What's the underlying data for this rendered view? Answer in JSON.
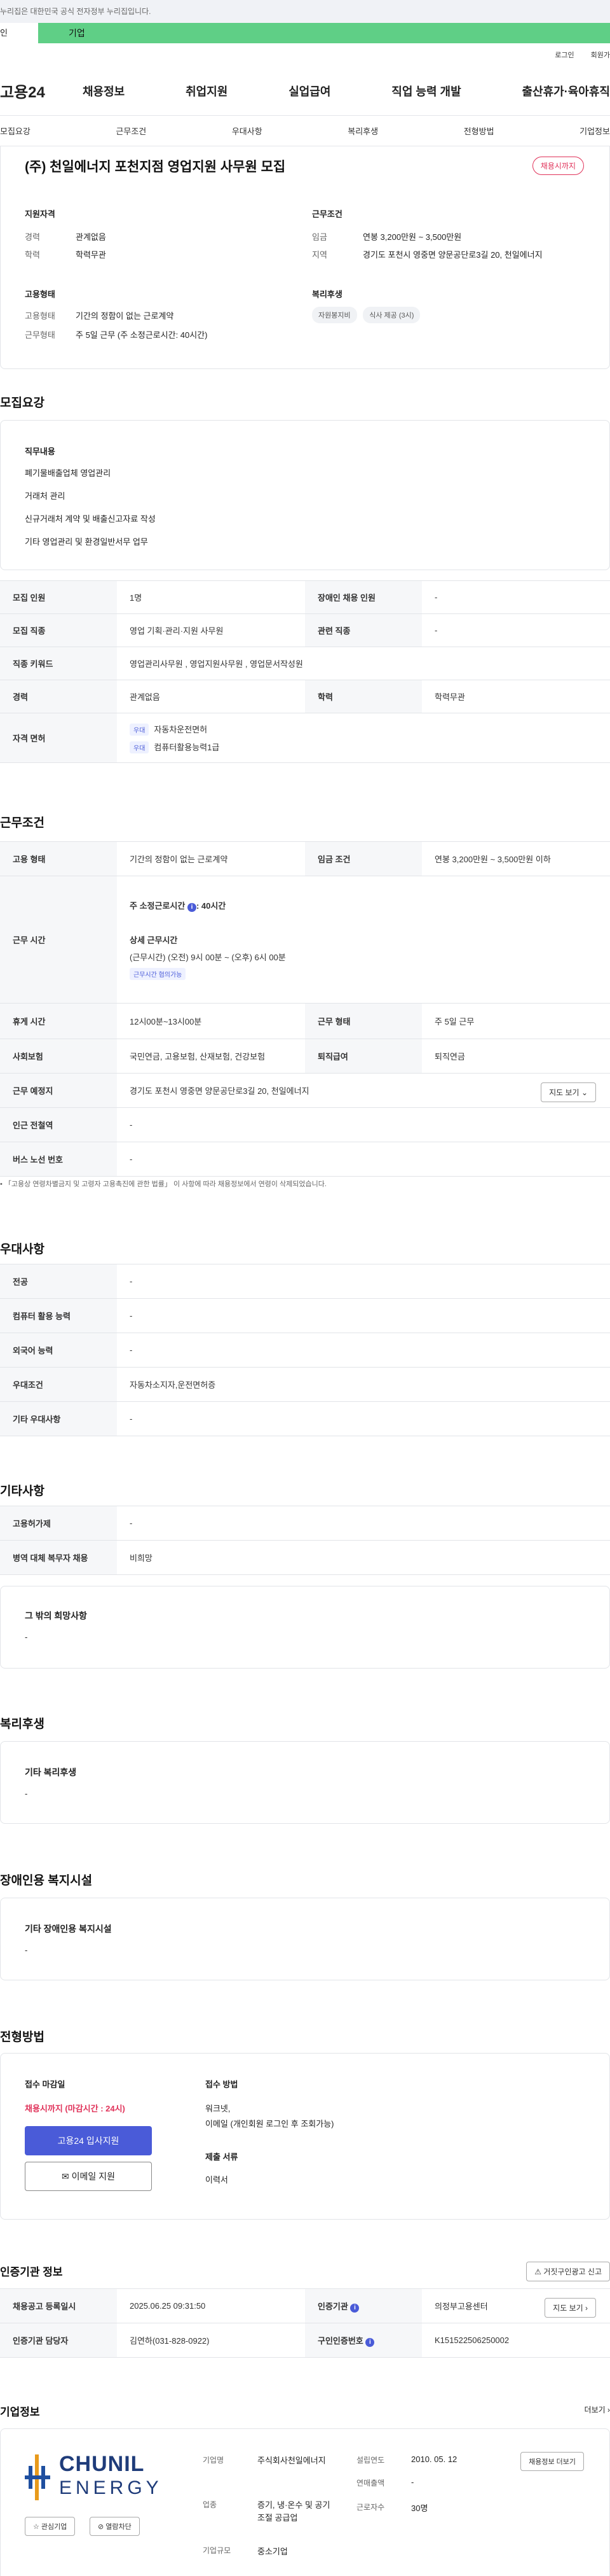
{
  "gov_notice": "누리집은 대한민국 공식 전자정부 누리집입니다.",
  "site_tabs": [
    "인",
    "기업"
  ],
  "util": [
    "로그인",
    "회원가"
  ],
  "logo": "고용24",
  "gnb": [
    "채용정보",
    "취업지원",
    "실업급여",
    "직업 능력 개발",
    "출산휴가·육아휴직"
  ],
  "tabs": [
    "모집요강",
    "근무조건",
    "우대사항",
    "복리후생",
    "전형방법",
    "기업정보"
  ],
  "title": "(주) 천일에너지 포천지점 영업지원 사무원 모집",
  "badge": "채용시까지",
  "summary": {
    "qual_title": "지원자격",
    "cond_title": "근무조건",
    "emp_title": "고용형태",
    "welfare_title": "복리후생",
    "career_k": "경력",
    "career_v": "관계없음",
    "edu_k": "학력",
    "edu_v": "학력무관",
    "pay_k": "임금",
    "pay_v": "연봉 3,200만원 ~ 3,500만원",
    "area_k": "지역",
    "area_v": "경기도 포천시 영중면 양문공단로3길 20, 천일에너지",
    "emp_k": "고용형태",
    "emp_v": "기간의 정함이 없는 근로계약",
    "type_k": "근무형태",
    "type_v": "주 5일 근무 (주 소정근로시간: 40시간)",
    "welfare": [
      "자원봉지비",
      "식사 제공 (3시)"
    ]
  },
  "recruit": {
    "title": "모집요강",
    "job_title": "직무내용",
    "job_lines": [
      "폐기물배출업체  영업관리",
      "거래처  관리",
      "신규거래처 계약 및 배출신고자료 작성",
      "기타 영업관리 및 환경일반서무 업무"
    ],
    "rows": [
      {
        "k": "모집 인원",
        "v": "1명",
        "k2": "장애인 채용 인원",
        "v2": "-"
      },
      {
        "k": "모집 직종",
        "v": "영업 기획·관리·지원 사무원",
        "k2": "관련 직종",
        "v2": "-"
      },
      {
        "k": "직종 키워드",
        "v": "영업관리사무원 , 영업지원사무원 , 영업문서작성원"
      },
      {
        "k": "경력",
        "v": "관계없음",
        "k2": "학력",
        "v2": "학력무관"
      },
      {
        "k": "자격 면허",
        "lic": [
          "자동차운전면허",
          "컴퓨터활용능력1급"
        ],
        "lic_tag": "우대"
      }
    ]
  },
  "work": {
    "title": "근무조건",
    "emp_k": "고용 형태",
    "emp_v": "기간의 정함이 없는 근로계약",
    "pay_k": "임금 조건",
    "pay_v": "연봉 3,200만원 ~ 3,500만원 이하",
    "time_k": "근무 시간",
    "time_h1": "주 소정근로시간",
    "time_h1v": ": 40시간",
    "time_h2": "상세 근무시간",
    "time_detail": "(근무시간) (오전) 9시 00분 ~ (오후) 6시 00분",
    "time_tag": "근무시간 협의가능",
    "rest_k": "휴게 시간",
    "rest_v": "12시00분~13시00분",
    "form_k": "근무 형태",
    "form_v": "주 5일 근무",
    "ins_k": "사회보험",
    "ins_v": "국민연금, 고용보험, 산재보험, 건강보험",
    "ret_k": "퇴직급여",
    "ret_v": "퇴직연금",
    "place_k": "근무 예정지",
    "place_v": "경기도 포천시 영중면 양문공단로3길 20, 천일에너지",
    "map_btn": "지도 보기",
    "subway_k": "인근 전철역",
    "subway_v": "-",
    "bus_k": "버스 노선 번호",
    "bus_v": "-",
    "note": "「고용상 연령차별금지 및 고령자 고용촉진에 관한 법률」 이 사항에 따라 채용정보에서 연령이 삭제되었습니다."
  },
  "pref": {
    "title": "우대사항",
    "rows": [
      {
        "k": "전공",
        "v": "-"
      },
      {
        "k": "컴퓨터 활용 능력",
        "v": "-"
      },
      {
        "k": "외국어 능력",
        "v": "-"
      },
      {
        "k": "우대조건",
        "v": "자동차소지자,운전면허증"
      },
      {
        "k": "기타 우대사항",
        "v": "-"
      }
    ]
  },
  "etc": {
    "title": "기타사항",
    "rows": [
      {
        "k": "고용허가제",
        "v": "-"
      },
      {
        "k": "병역 대체 복무자 채용",
        "v": "비희망"
      }
    ],
    "hope_title": "그 밖의 희망사항",
    "hope_v": "-"
  },
  "welfare_sec": {
    "title": "복리후생",
    "lbl": "기타 복리후생",
    "v": "-"
  },
  "disabled_sec": {
    "title": "장애인용 복지시설",
    "lbl": "기타 장애인용 복지시설",
    "v": "-"
  },
  "apply": {
    "title": "전형방법",
    "deadline_lbl": "접수 마감일",
    "deadline_v": "채용시까지 (마감시간 : 24시)",
    "btn_apply": "고용24 입사지원",
    "btn_email": "이메일 지원",
    "method_lbl": "접수 방법",
    "method_v": "워크넷,",
    "method_v2": "이메일 (개인회원 로그인 후 조회가능)",
    "docs_lbl": "제출 서류",
    "docs_v": "이력서"
  },
  "cert": {
    "title": "인증기관 정보",
    "report_btn": "거짓구인광고 신고",
    "rows": [
      {
        "k": "채용공고 등록일시",
        "v": "2025.06.25 09:31:50",
        "k2": "인증기관",
        "v2": "의정부고용센터",
        "btn": "지도 보기"
      },
      {
        "k": "인증기관 담당자",
        "v": "김연하(031-828-0922)",
        "k2": "구인인증번호",
        "v2": "K151522506250002"
      }
    ]
  },
  "company": {
    "title": "기업정보",
    "more": "더보기",
    "logo1": "CHUNIL",
    "logo2": "ENERGY",
    "fav_btn": "관심기업",
    "block_btn": "열람차단",
    "info_btn": "채용정보 더보기",
    "name_k": "기업명",
    "name_v": "주식회사천일에너지",
    "ind_k": "업종",
    "ind_v": "증기, 냉·온수 및 공기조절 공급업",
    "size_k": "기업규모",
    "size_v": "중소기업",
    "est_k": "설립연도",
    "est_v": "2010. 05. 12",
    "sales_k": "연매출액",
    "sales_v": "-",
    "emp_k": "근로자수",
    "emp_v": "30명"
  },
  "colors": {
    "accent": "#4a5bd8",
    "green": "#5fcf86",
    "red": "#e0335a"
  }
}
